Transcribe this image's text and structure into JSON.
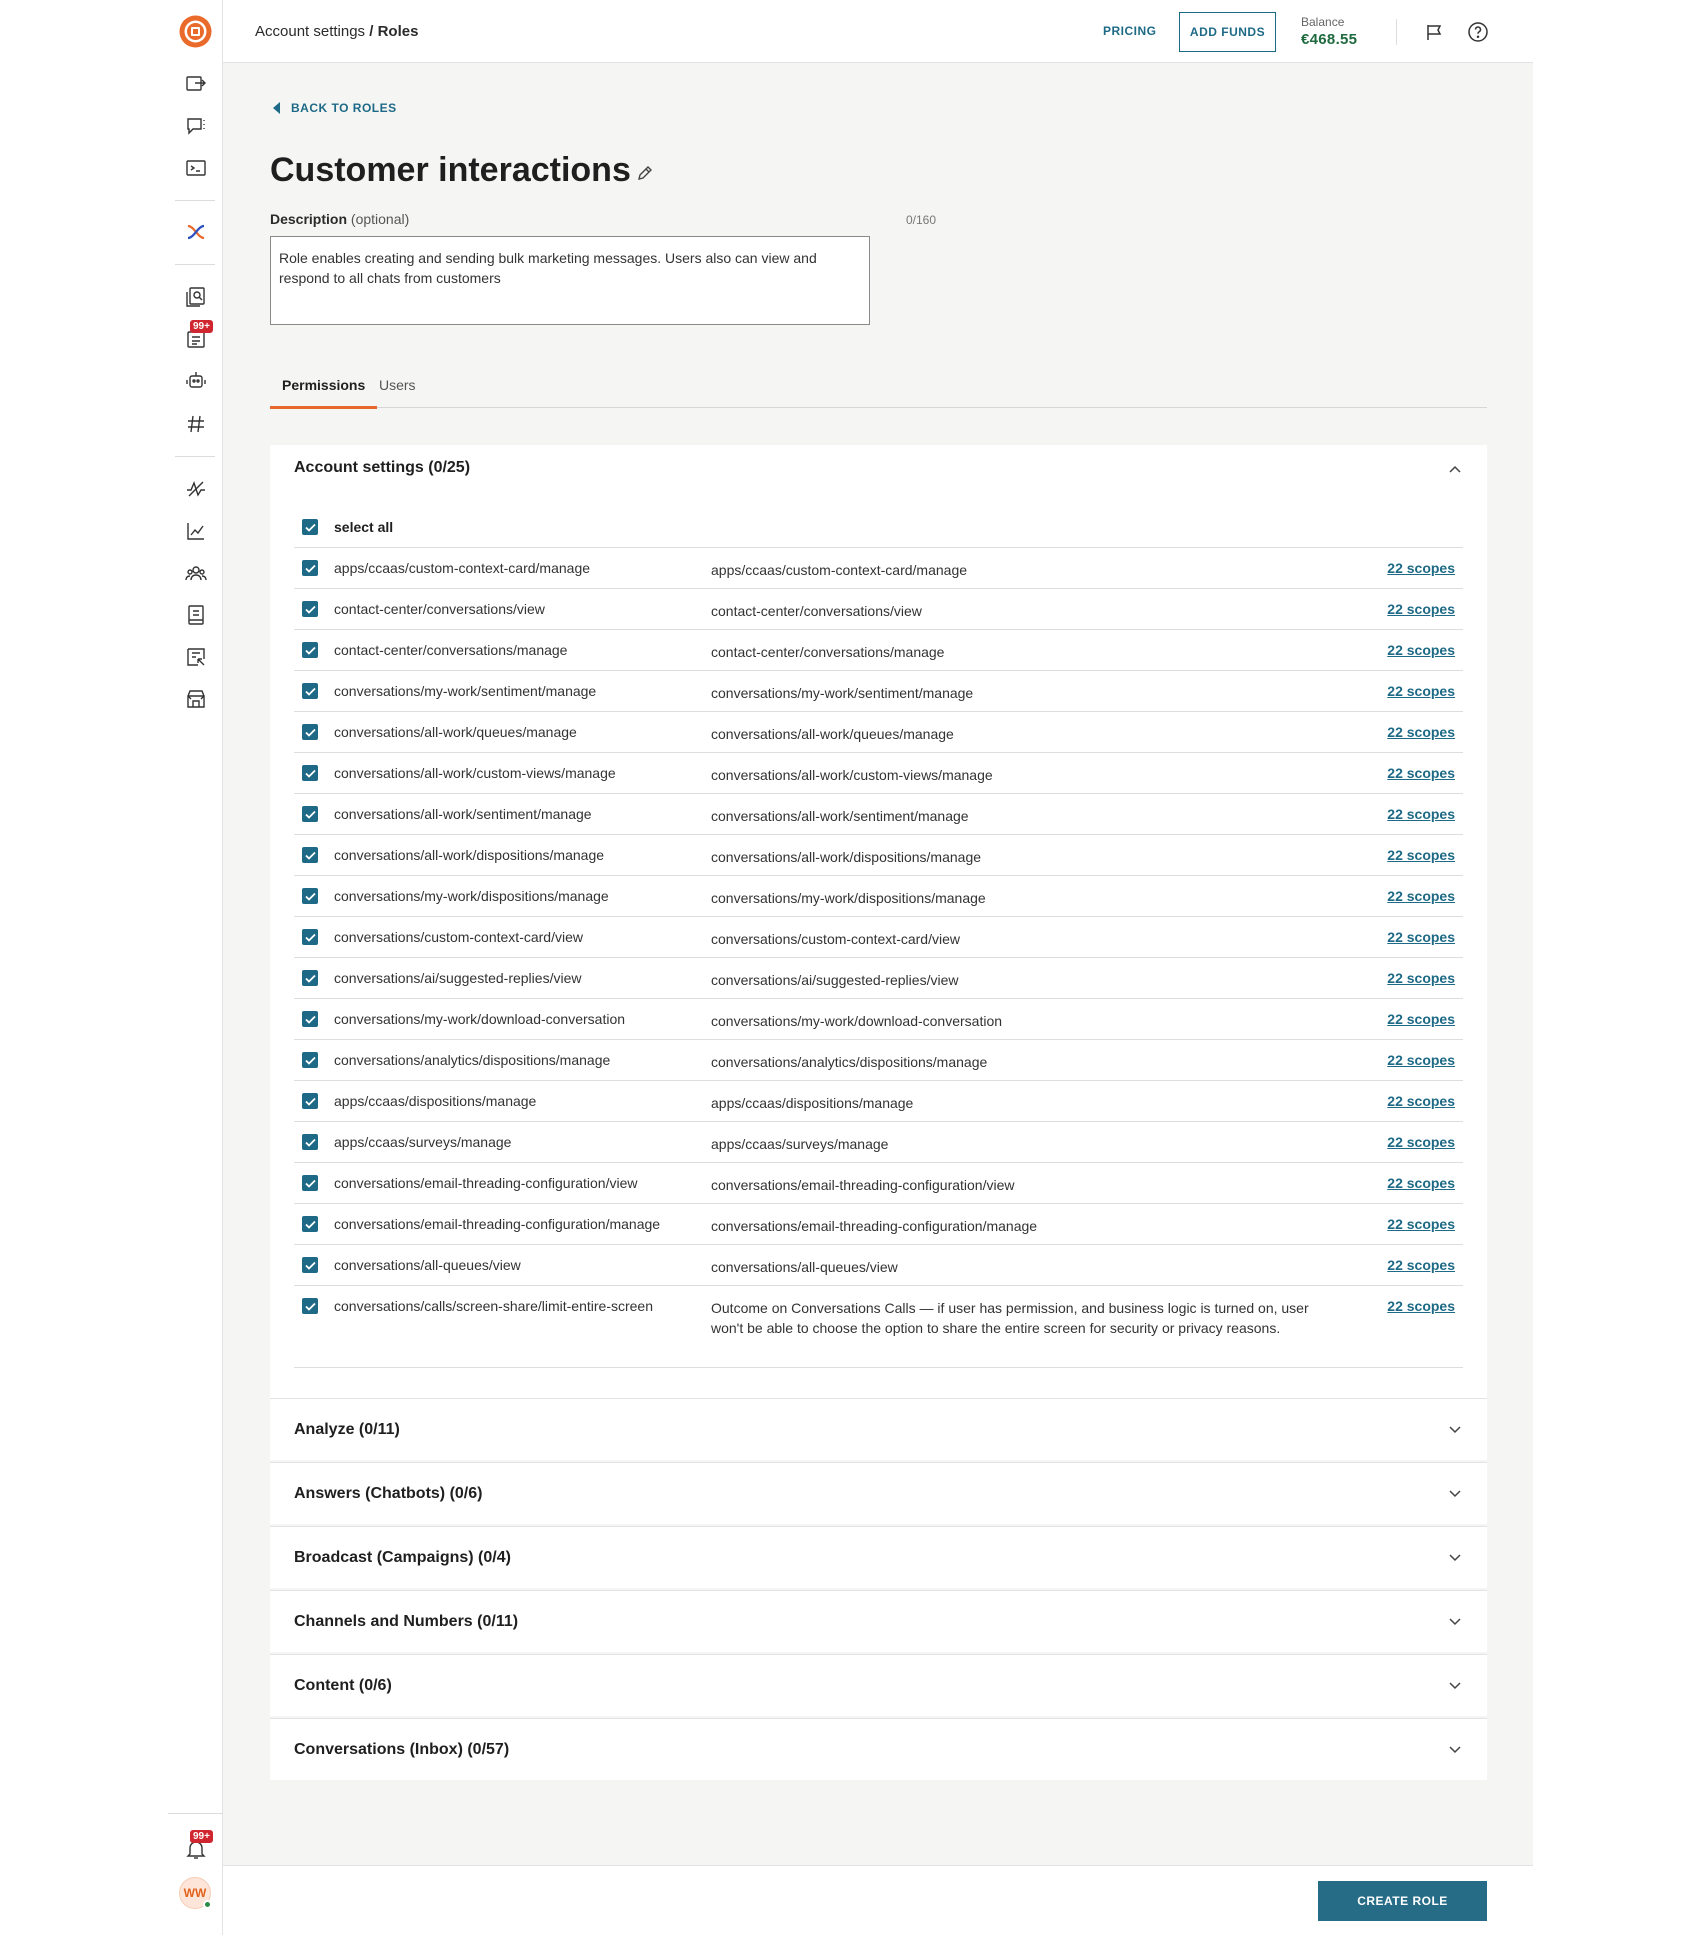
{
  "header": {
    "breadcrumb_parent": "Account settings",
    "breadcrumb_separator": " / ",
    "breadcrumb_current": "Roles",
    "pricing_label": "PRICING",
    "add_funds_label": "ADD FUNDS",
    "balance_label": "Balance",
    "balance_value": "€468.55"
  },
  "sidebar": {
    "badge_top": "99+",
    "badge_bottom": "99+",
    "avatar_initials": "WW"
  },
  "main": {
    "back_label": "BACK TO ROLES",
    "title": "Customer interactions",
    "description_label": "Description",
    "description_optional": "(optional)",
    "description_count": "0/160",
    "description_value": "Role enables creating and sending bulk marketing messages. Users also can view and respond to all chats from customers",
    "tabs": [
      {
        "label": "Permissions"
      },
      {
        "label": "Users"
      }
    ]
  },
  "permissions": {
    "section_title": "Account settings (0/25)",
    "select_all_label": "select all",
    "rows": [
      {
        "name": "apps/ccaas/custom-context-card/manage",
        "desc": "apps/ccaas/custom-context-card/manage",
        "scopes": "22 scopes"
      },
      {
        "name": "contact-center/conversations/view",
        "desc": "contact-center/conversations/view",
        "scopes": "22 scopes"
      },
      {
        "name": "contact-center/conversations/manage",
        "desc": "contact-center/conversations/manage",
        "scopes": "22 scopes"
      },
      {
        "name": "conversations/my-work/sentiment/manage",
        "desc": "conversations/my-work/sentiment/manage",
        "scopes": "22 scopes"
      },
      {
        "name": "conversations/all-work/queues/manage",
        "desc": "conversations/all-work/queues/manage",
        "scopes": "22 scopes"
      },
      {
        "name": "conversations/all-work/custom-views/manage",
        "desc": "conversations/all-work/custom-views/manage",
        "scopes": "22 scopes"
      },
      {
        "name": "conversations/all-work/sentiment/manage",
        "desc": "conversations/all-work/sentiment/manage",
        "scopes": "22 scopes"
      },
      {
        "name": "conversations/all-work/dispositions/manage",
        "desc": "conversations/all-work/dispositions/manage",
        "scopes": "22 scopes"
      },
      {
        "name": "conversations/my-work/dispositions/manage",
        "desc": "conversations/my-work/dispositions/manage",
        "scopes": "22 scopes"
      },
      {
        "name": "conversations/custom-context-card/view",
        "desc": "conversations/custom-context-card/view",
        "scopes": "22 scopes"
      },
      {
        "name": "conversations/ai/suggested-replies/view",
        "desc": "conversations/ai/suggested-replies/view",
        "scopes": "22 scopes"
      },
      {
        "name": "conversations/my-work/download-conversation",
        "desc": "conversations/my-work/download-conversation",
        "scopes": "22 scopes"
      },
      {
        "name": "conversations/analytics/dispositions/manage",
        "desc": "conversations/analytics/dispositions/manage",
        "scopes": "22 scopes"
      },
      {
        "name": "apps/ccaas/dispositions/manage",
        "desc": "apps/ccaas/dispositions/manage",
        "scopes": "22 scopes"
      },
      {
        "name": "apps/ccaas/surveys/manage",
        "desc": "apps/ccaas/surveys/manage",
        "scopes": "22 scopes"
      },
      {
        "name": "conversations/email-threading-configuration/view",
        "desc": "conversations/email-threading-configuration/view",
        "scopes": "22 scopes"
      },
      {
        "name": "conversations/email-threading-configuration/manage",
        "desc": "conversations/email-threading-configuration/manage",
        "scopes": "22 scopes"
      },
      {
        "name": "conversations/all-queues/view",
        "desc": "conversations/all-queues/view",
        "scopes": "22 scopes"
      },
      {
        "name": "conversations/calls/screen-share/limit-entire-screen",
        "desc": "Outcome on Conversations Calls — if user has permission, and business logic is turned on, user won't be able to choose the option to share the entire screen for security or privacy reasons.",
        "scopes": "22 scopes"
      }
    ]
  },
  "sections": [
    {
      "title": "Analyze (0/11)"
    },
    {
      "title": "Answers (Chatbots) (0/6)"
    },
    {
      "title": "Broadcast (Campaigns) (0/4)"
    },
    {
      "title": "Channels and Numbers (0/11)"
    },
    {
      "title": "Content (0/6)"
    },
    {
      "title": "Conversations (Inbox) (0/57)"
    }
  ],
  "footer": {
    "create_label": "CREATE ROLE"
  },
  "colors": {
    "accent": "#1e6a86",
    "brand": "#e8672d",
    "balance": "#1e6a3e",
    "badge": "#d0262f"
  },
  "icons": [
    "logo-icon",
    "export-icon",
    "chat-icon",
    "terminal-icon",
    "flow-icon",
    "document-search-icon",
    "forms-icon",
    "bot-icon",
    "hashtag-icon",
    "pulse-icon",
    "analytics-icon",
    "people-icon",
    "book-icon",
    "report-icon",
    "store-icon",
    "bell-icon",
    "megaphone-icon",
    "help-icon",
    "edit-icon",
    "chevron-up-icon",
    "chevron-down-icon",
    "check-icon",
    "caret-left-icon"
  ]
}
